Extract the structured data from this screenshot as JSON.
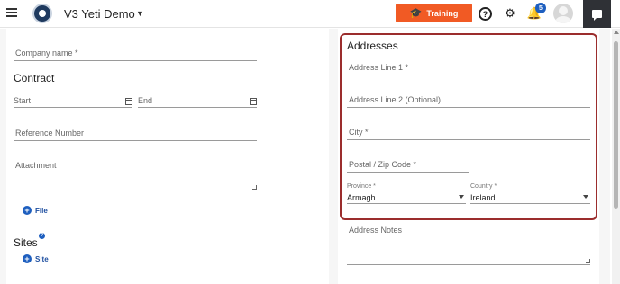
{
  "header": {
    "app_title": "V3 Yeti Demo",
    "training_label": "Training",
    "notification_count": "5"
  },
  "left": {
    "company_name_label": "Company name *",
    "contract_heading": "Contract",
    "start_label": "Start",
    "end_label": "End",
    "reference_label": "Reference Number",
    "attachment_label": "Attachment",
    "file_button": "File",
    "sites_heading": "Sites",
    "site_button": "Site"
  },
  "right": {
    "addresses_heading": "Addresses",
    "line1_label": "Address Line 1 *",
    "line2_label": "Address Line 2 (Optional)",
    "city_label": "City *",
    "postal_label": "Postal / Zip Code *",
    "province_label": "Province *",
    "province_value": "Armagh",
    "country_label": "Country *",
    "country_value": "Ireland",
    "notes_label": "Address Notes"
  },
  "icons": {
    "menu": "hamburger-menu-icon",
    "logo": "app-logo",
    "help": "help-icon",
    "settings": "gear-icon",
    "notifications": "bell-icon",
    "chat": "chat-icon"
  },
  "colors": {
    "training_button": "#f15a24",
    "accent_blue": "#1e5fbf",
    "highlight_border": "#9b2d2d"
  }
}
